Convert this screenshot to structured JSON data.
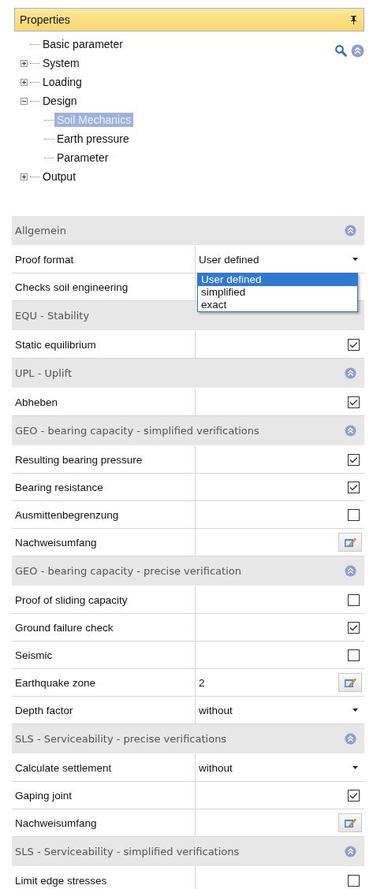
{
  "panel": {
    "title": "Properties"
  },
  "tree": [
    {
      "label": "Basic parameter",
      "selected": false
    },
    {
      "label": "System",
      "expanded": false,
      "selected": false
    },
    {
      "label": "Loading",
      "expanded": false,
      "selected": false
    },
    {
      "label": "Design",
      "expanded": true,
      "selected": false,
      "children": [
        {
          "label": "Soil Mechanics",
          "selected": true
        },
        {
          "label": "Earth pressure",
          "selected": false
        },
        {
          "label": "Parameter",
          "selected": false
        }
      ]
    },
    {
      "label": "Output",
      "expanded": false,
      "selected": false
    }
  ],
  "sections": [
    {
      "title": "Allgemein",
      "covered": false,
      "rows": [
        {
          "kind": "dropdown",
          "label": "Proof format",
          "value": "User defined",
          "open": true,
          "options": [
            {
              "label": "User defined",
              "selected": true
            },
            {
              "label": "simplified",
              "selected": false
            },
            {
              "label": "exact",
              "selected": false
            }
          ]
        },
        {
          "kind": "blank",
          "label": "Checks soil engineering"
        }
      ]
    },
    {
      "title": "EQU - Stability",
      "covered": true,
      "rows": [
        {
          "kind": "check",
          "label": "Static equilibrium",
          "checked": true
        }
      ]
    },
    {
      "title": "UPL - Uplift",
      "covered": false,
      "rows": [
        {
          "kind": "check",
          "label": "Abheben",
          "checked": true
        }
      ]
    },
    {
      "title": "GEO - bearing capacity - simplified verifications",
      "covered": false,
      "rows": [
        {
          "kind": "check",
          "label": "Resulting bearing pressure",
          "checked": true
        },
        {
          "kind": "check",
          "label": "Bearing resistance",
          "checked": true
        },
        {
          "kind": "check",
          "label": "Ausmittenbegrenzung",
          "checked": false
        },
        {
          "kind": "edit",
          "label": "Nachweisumfang"
        }
      ]
    },
    {
      "title": "GEO - bearing capacity - precise verification",
      "covered": false,
      "rows": [
        {
          "kind": "check",
          "label": "Proof of sliding capacity",
          "checked": false
        },
        {
          "kind": "check",
          "label": "Ground failure check",
          "checked": true
        },
        {
          "kind": "check",
          "label": "Seismic",
          "checked": false
        },
        {
          "kind": "edit",
          "label": "Earthquake zone",
          "value": "2"
        },
        {
          "kind": "dropdown",
          "label": "Depth factor",
          "value": "without"
        }
      ]
    },
    {
      "title": "SLS - Serviceability - precise verifications",
      "covered": false,
      "rows": [
        {
          "kind": "dropdown",
          "label": "Calculate settlement",
          "value": "without"
        },
        {
          "kind": "check",
          "label": "Gaping joint",
          "checked": true
        },
        {
          "kind": "edit",
          "label": "Nachweisumfang"
        }
      ]
    },
    {
      "title": "SLS - Serviceability - simplified verifications",
      "covered": false,
      "rows": [
        {
          "kind": "check",
          "label": "Limit edge stresses",
          "checked": false
        }
      ]
    }
  ]
}
